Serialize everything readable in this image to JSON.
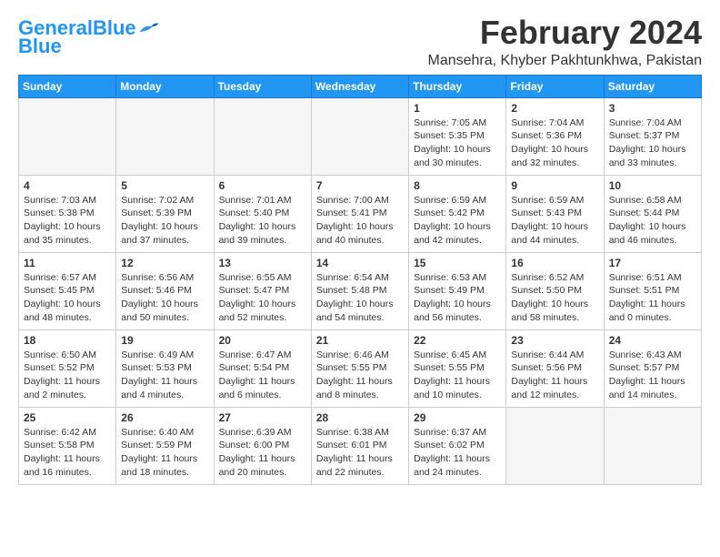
{
  "header": {
    "logo_general": "General",
    "logo_blue": "Blue",
    "month_title": "February 2024",
    "location": "Mansehra, Khyber Pakhtunkhwa, Pakistan"
  },
  "weekdays": [
    "Sunday",
    "Monday",
    "Tuesday",
    "Wednesday",
    "Thursday",
    "Friday",
    "Saturday"
  ],
  "weeks": [
    [
      {
        "day": "",
        "sunrise": "",
        "sunset": "",
        "daylight": ""
      },
      {
        "day": "",
        "sunrise": "",
        "sunset": "",
        "daylight": ""
      },
      {
        "day": "",
        "sunrise": "",
        "sunset": "",
        "daylight": ""
      },
      {
        "day": "",
        "sunrise": "",
        "sunset": "",
        "daylight": ""
      },
      {
        "day": "1",
        "sunrise": "Sunrise: 7:05 AM",
        "sunset": "Sunset: 5:35 PM",
        "daylight": "Daylight: 10 hours and 30 minutes."
      },
      {
        "day": "2",
        "sunrise": "Sunrise: 7:04 AM",
        "sunset": "Sunset: 5:36 PM",
        "daylight": "Daylight: 10 hours and 32 minutes."
      },
      {
        "day": "3",
        "sunrise": "Sunrise: 7:04 AM",
        "sunset": "Sunset: 5:37 PM",
        "daylight": "Daylight: 10 hours and 33 minutes."
      }
    ],
    [
      {
        "day": "4",
        "sunrise": "Sunrise: 7:03 AM",
        "sunset": "Sunset: 5:38 PM",
        "daylight": "Daylight: 10 hours and 35 minutes."
      },
      {
        "day": "5",
        "sunrise": "Sunrise: 7:02 AM",
        "sunset": "Sunset: 5:39 PM",
        "daylight": "Daylight: 10 hours and 37 minutes."
      },
      {
        "day": "6",
        "sunrise": "Sunrise: 7:01 AM",
        "sunset": "Sunset: 5:40 PM",
        "daylight": "Daylight: 10 hours and 39 minutes."
      },
      {
        "day": "7",
        "sunrise": "Sunrise: 7:00 AM",
        "sunset": "Sunset: 5:41 PM",
        "daylight": "Daylight: 10 hours and 40 minutes."
      },
      {
        "day": "8",
        "sunrise": "Sunrise: 6:59 AM",
        "sunset": "Sunset: 5:42 PM",
        "daylight": "Daylight: 10 hours and 42 minutes."
      },
      {
        "day": "9",
        "sunrise": "Sunrise: 6:59 AM",
        "sunset": "Sunset: 5:43 PM",
        "daylight": "Daylight: 10 hours and 44 minutes."
      },
      {
        "day": "10",
        "sunrise": "Sunrise: 6:58 AM",
        "sunset": "Sunset: 5:44 PM",
        "daylight": "Daylight: 10 hours and 46 minutes."
      }
    ],
    [
      {
        "day": "11",
        "sunrise": "Sunrise: 6:57 AM",
        "sunset": "Sunset: 5:45 PM",
        "daylight": "Daylight: 10 hours and 48 minutes."
      },
      {
        "day": "12",
        "sunrise": "Sunrise: 6:56 AM",
        "sunset": "Sunset: 5:46 PM",
        "daylight": "Daylight: 10 hours and 50 minutes."
      },
      {
        "day": "13",
        "sunrise": "Sunrise: 6:55 AM",
        "sunset": "Sunset: 5:47 PM",
        "daylight": "Daylight: 10 hours and 52 minutes."
      },
      {
        "day": "14",
        "sunrise": "Sunrise: 6:54 AM",
        "sunset": "Sunset: 5:48 PM",
        "daylight": "Daylight: 10 hours and 54 minutes."
      },
      {
        "day": "15",
        "sunrise": "Sunrise: 6:53 AM",
        "sunset": "Sunset: 5:49 PM",
        "daylight": "Daylight: 10 hours and 56 minutes."
      },
      {
        "day": "16",
        "sunrise": "Sunrise: 6:52 AM",
        "sunset": "Sunset: 5:50 PM",
        "daylight": "Daylight: 10 hours and 58 minutes."
      },
      {
        "day": "17",
        "sunrise": "Sunrise: 6:51 AM",
        "sunset": "Sunset: 5:51 PM",
        "daylight": "Daylight: 11 hours and 0 minutes."
      }
    ],
    [
      {
        "day": "18",
        "sunrise": "Sunrise: 6:50 AM",
        "sunset": "Sunset: 5:52 PM",
        "daylight": "Daylight: 11 hours and 2 minutes."
      },
      {
        "day": "19",
        "sunrise": "Sunrise: 6:49 AM",
        "sunset": "Sunset: 5:53 PM",
        "daylight": "Daylight: 11 hours and 4 minutes."
      },
      {
        "day": "20",
        "sunrise": "Sunrise: 6:47 AM",
        "sunset": "Sunset: 5:54 PM",
        "daylight": "Daylight: 11 hours and 6 minutes."
      },
      {
        "day": "21",
        "sunrise": "Sunrise: 6:46 AM",
        "sunset": "Sunset: 5:55 PM",
        "daylight": "Daylight: 11 hours and 8 minutes."
      },
      {
        "day": "22",
        "sunrise": "Sunrise: 6:45 AM",
        "sunset": "Sunset: 5:55 PM",
        "daylight": "Daylight: 11 hours and 10 minutes."
      },
      {
        "day": "23",
        "sunrise": "Sunrise: 6:44 AM",
        "sunset": "Sunset: 5:56 PM",
        "daylight": "Daylight: 11 hours and 12 minutes."
      },
      {
        "day": "24",
        "sunrise": "Sunrise: 6:43 AM",
        "sunset": "Sunset: 5:57 PM",
        "daylight": "Daylight: 11 hours and 14 minutes."
      }
    ],
    [
      {
        "day": "25",
        "sunrise": "Sunrise: 6:42 AM",
        "sunset": "Sunset: 5:58 PM",
        "daylight": "Daylight: 11 hours and 16 minutes."
      },
      {
        "day": "26",
        "sunrise": "Sunrise: 6:40 AM",
        "sunset": "Sunset: 5:59 PM",
        "daylight": "Daylight: 11 hours and 18 minutes."
      },
      {
        "day": "27",
        "sunrise": "Sunrise: 6:39 AM",
        "sunset": "Sunset: 6:00 PM",
        "daylight": "Daylight: 11 hours and 20 minutes."
      },
      {
        "day": "28",
        "sunrise": "Sunrise: 6:38 AM",
        "sunset": "Sunset: 6:01 PM",
        "daylight": "Daylight: 11 hours and 22 minutes."
      },
      {
        "day": "29",
        "sunrise": "Sunrise: 6:37 AM",
        "sunset": "Sunset: 6:02 PM",
        "daylight": "Daylight: 11 hours and 24 minutes."
      },
      {
        "day": "",
        "sunrise": "",
        "sunset": "",
        "daylight": ""
      },
      {
        "day": "",
        "sunrise": "",
        "sunset": "",
        "daylight": ""
      }
    ]
  ]
}
